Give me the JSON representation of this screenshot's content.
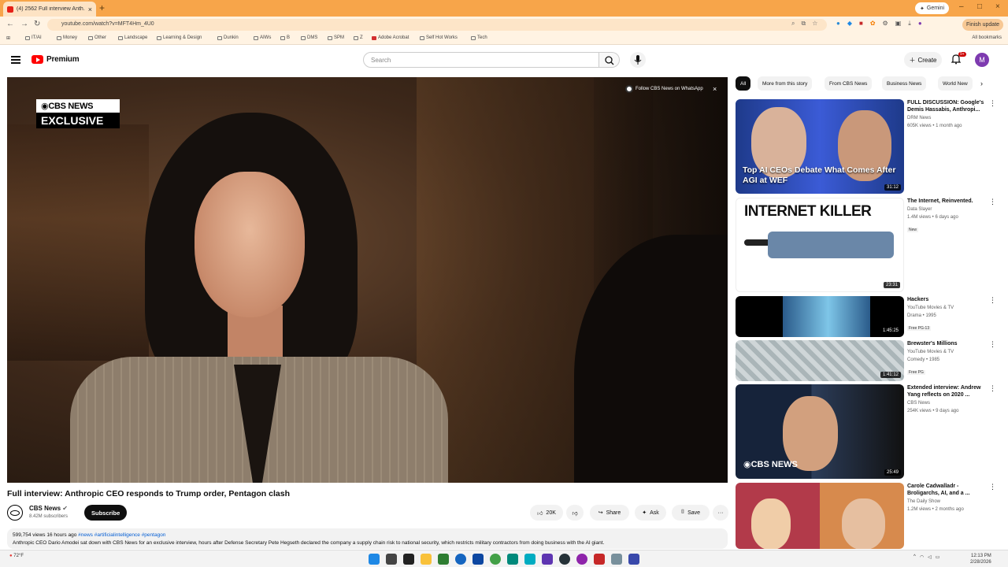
{
  "browser": {
    "tab_title": "(4) 2562 Full interview Anth...",
    "new_tab_icon": "plus-icon",
    "gemini_label": "Gemini",
    "url": "youtube.com/watch?v=MFT4Hm_4U0",
    "profile_label": "Finish update",
    "all_bookmarks": "All bookmarks",
    "bookmarks": [
      "IT/AI",
      "Money",
      "Other",
      "Landscape",
      "Learning & Design",
      "Dunkin",
      "AIWs",
      "B",
      "DMS",
      "SPM",
      "Z",
      "Adobe Acrobat",
      "Self Hot Works",
      "Tech"
    ]
  },
  "youtube": {
    "logo_text": "Premium",
    "search_placeholder": "Search",
    "create_label": "Create",
    "notif_count": "9+",
    "avatar_letter": "M"
  },
  "video": {
    "overlay_top": "CBS NEWS",
    "overlay_bottom": "EXCLUSIVE",
    "follow_text": "Follow CBS News on WhatsApp",
    "title": "Full interview: Anthropic CEO responds to Trump order, Pentagon clash",
    "channel_name": "CBS News",
    "channel_subs": "8.42M subscribers",
    "subscribe_label": "Subscribe",
    "like_count": "20K",
    "share_label": "Share",
    "ask_label": "Ask",
    "save_label": "Save",
    "desc_meta": "599,754 views  16 hours ago",
    "desc_tags": "#news #artificialintelligence #pentagon",
    "desc_text": "Anthropic CEO Dario Amodei sat down with CBS News for an exclusive interview, hours after Defense Secretary Pete Hegseth declared the company a supply chain risk to national security, which restricts military contractors from doing business with the AI giant."
  },
  "sidebar": {
    "chips": [
      "All",
      "More from this story",
      "From CBS News",
      "Business News",
      "World New"
    ],
    "recs": [
      {
        "title": "FULL DISCUSSION: Google's Demis Hassabis, Anthropi...",
        "channel": "DRM News",
        "meta": "605K views • 1 month ago",
        "duration": "31:12",
        "caption": "Top AI CEOs Debate What Comes After AGI at WEF",
        "badge": ""
      },
      {
        "title": "The Internet, Reinvented.",
        "channel": "Data Slayer",
        "meta": "1.4M views • 6 days ago",
        "duration": "23:31",
        "caption": "INTERNET KILLER",
        "badge": "New"
      },
      {
        "title": "Hackers",
        "channel": "YouTube Movies & TV",
        "meta": "Drama • 1995",
        "duration": "1:45:25",
        "caption": "",
        "badge": "Free  PG-13"
      },
      {
        "title": "Brewster's Millions",
        "channel": "YouTube Movies & TV",
        "meta": "Comedy • 1985",
        "duration": "1:41:12",
        "caption": "",
        "badge": "Free  PG"
      },
      {
        "title": "Extended interview: Andrew Yang reflects on 2020 ...",
        "channel": "CBS News",
        "meta": "254K views • 9 days ago",
        "duration": "25:49",
        "caption": "CBS NEWS",
        "badge": ""
      },
      {
        "title": "Carole Cadwalladr - Broligarchs, AI, and a ...",
        "channel": "The Daily Show",
        "meta": "1.2M views • 2 months ago",
        "duration": "",
        "caption": "",
        "badge": ""
      }
    ]
  },
  "taskbar": {
    "weather": "72°F",
    "time": "12:13 PM",
    "date": "2/28/2026"
  }
}
